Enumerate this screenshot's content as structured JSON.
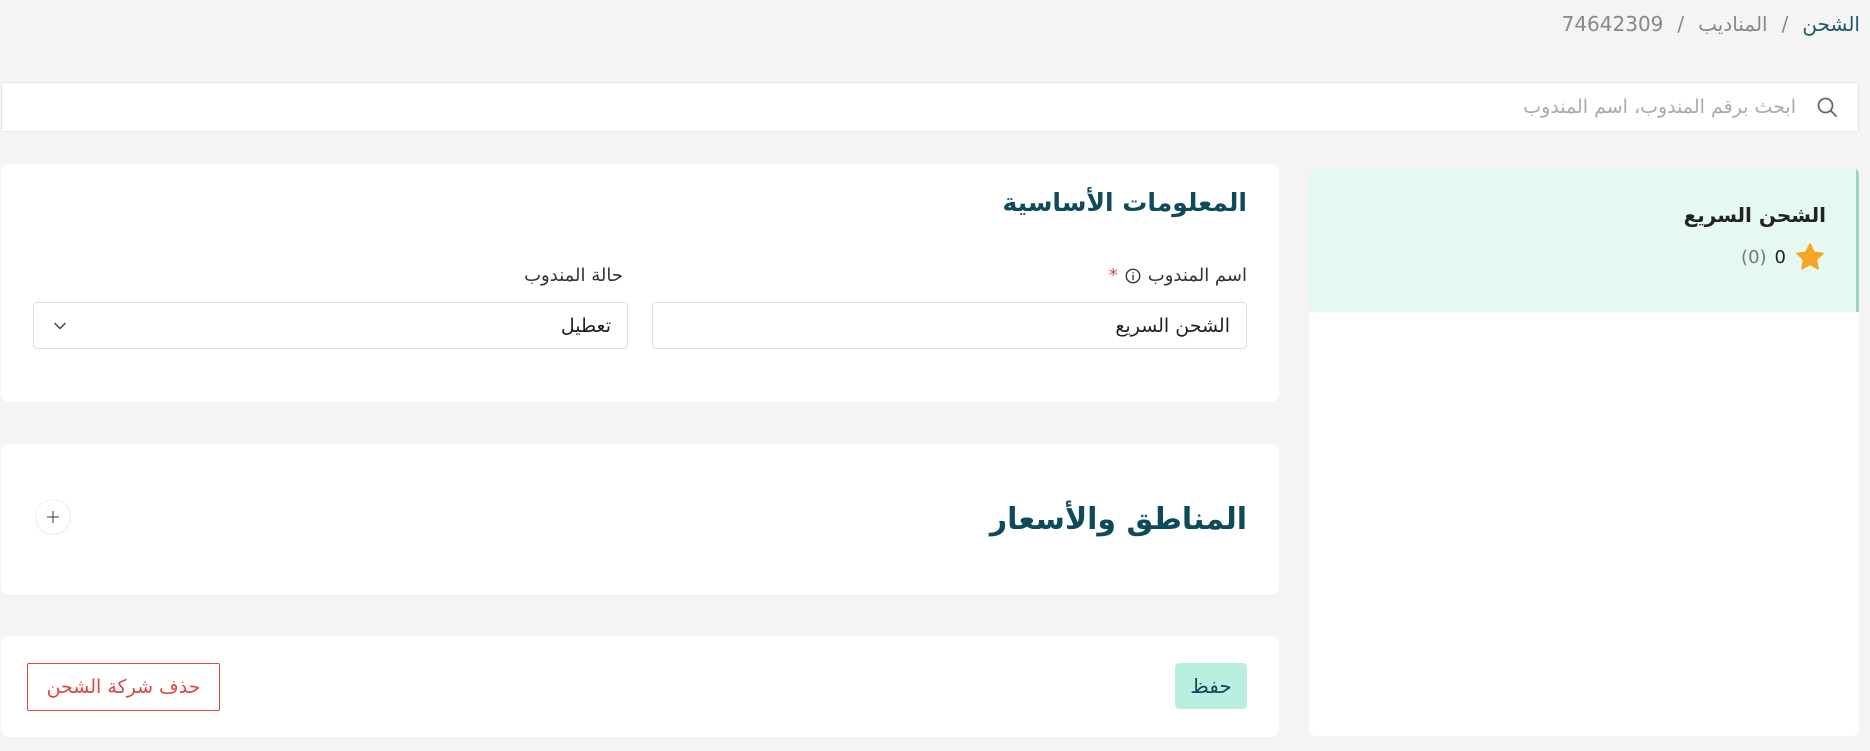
{
  "breadcrumb": {
    "root": "الشحن",
    "section": "المناديب",
    "current": "74642309",
    "separator": "/"
  },
  "search": {
    "placeholder": "ابحث برقم المندوب، اسم المندوب",
    "value": ""
  },
  "sidebar": {
    "items": [
      {
        "name": "الشحن السريع",
        "rating": "0",
        "rating_count": "(0)",
        "selected": true
      }
    ]
  },
  "basic_info": {
    "title": "المعلومات الأساسية",
    "name_label": "اسم المندوب",
    "required_mark": "*",
    "name_value": "الشحن السريع",
    "status_label": "حالة المندوب",
    "status_value": "تعطيل"
  },
  "zones": {
    "title": "المناطق والأسعار"
  },
  "actions": {
    "save_label": "حفظ",
    "delete_label": "حذف شركة الشحن"
  },
  "colors": {
    "accent": "#0f4a5a",
    "selected_bg": "#e6f8f2",
    "save_bg": "#b9efe1",
    "danger": "#e04545",
    "star": "#f5a623"
  }
}
